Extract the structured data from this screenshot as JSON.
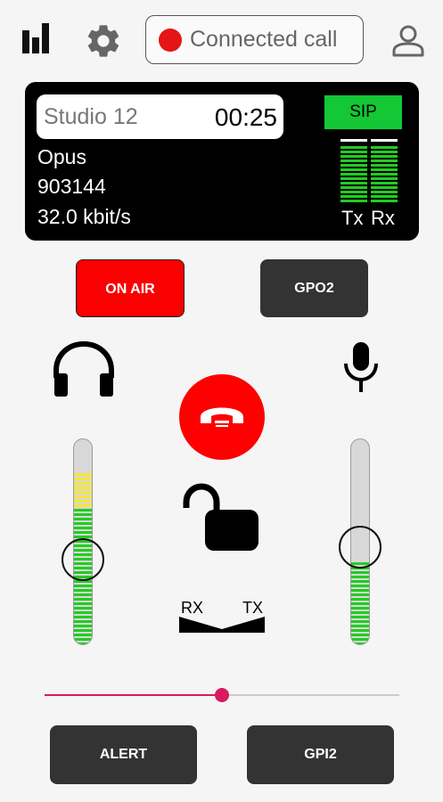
{
  "header": {
    "call_status": "Connected call",
    "record_indicator_color": "#e61515"
  },
  "info_panel": {
    "station": "Studio 12",
    "timer": "00:25",
    "codec": "Opus",
    "number": "903144",
    "bitrate": "32.0 kbit/s",
    "protocol": "SIP",
    "tx_label": "Tx",
    "rx_label": "Rx"
  },
  "buttons": {
    "on_air": "ON AIR",
    "gpo2": "GPO2",
    "alert": "ALERT",
    "gpi2": "GPI2"
  },
  "balance": {
    "rx_label": "RX",
    "tx_label": "TX",
    "value_fraction": 0.5
  },
  "faders": {
    "headphones_level_fraction": 0.49,
    "headphones_meter_fraction": 0.85,
    "mic_level_fraction": 0.49,
    "mic_meter_fraction": 0.42
  },
  "slider": {
    "value_fraction": 0.5
  },
  "colors": {
    "on_air": "#fb0000",
    "hangup": "#fe0000",
    "meter_green": "#22cc22",
    "meter_yellow": "#f5e63a",
    "sip_badge": "#13c735",
    "slider_accent": "#d81b60"
  },
  "icons": [
    "stats-icon",
    "gear-icon",
    "user-icon",
    "headphones-icon",
    "mic-icon",
    "hangup-phone-icon",
    "lock-open-icon"
  ]
}
